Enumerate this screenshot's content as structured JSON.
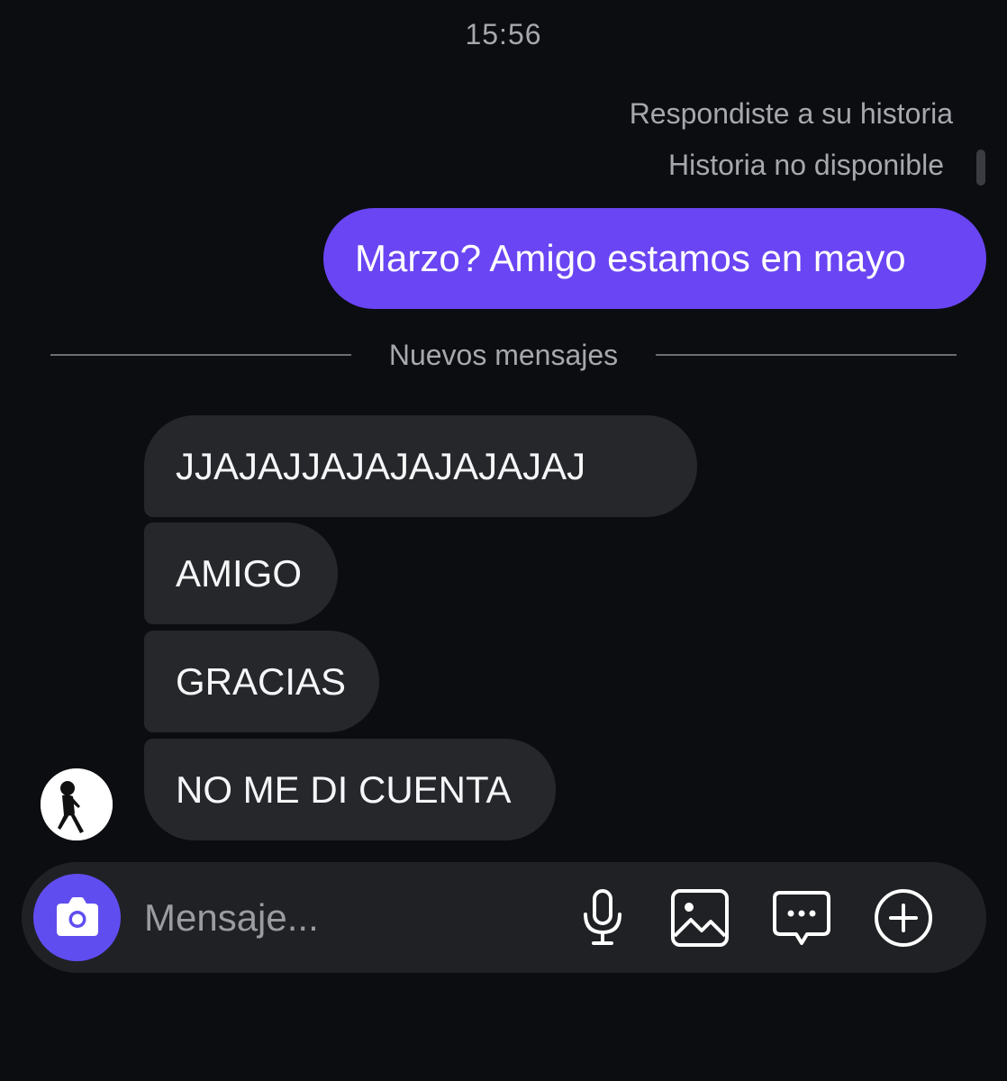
{
  "header": {
    "time": "15:56"
  },
  "story": {
    "reply_label": "Respondiste a su historia",
    "unavailable_label": "Historia no disponible"
  },
  "messages": {
    "outgoing": [
      {
        "text": "Marzo? Amigo estamos en mayo"
      }
    ],
    "divider_label": "Nuevos mensajes",
    "incoming": [
      {
        "text": "JJAJAJJAJAJAJAJAJAJ"
      },
      {
        "text": "AMIGO"
      },
      {
        "text": "GRACIAS"
      },
      {
        "text": "NO ME DI CUENTA"
      }
    ]
  },
  "composer": {
    "placeholder": "Mensaje..."
  },
  "colors": {
    "background": "#0b0d11",
    "outgoing_bubble": "#6a45f3",
    "incoming_bubble": "#26272b",
    "camera_button": "#5f4df0",
    "secondary_text": "#a6a8ad"
  },
  "icons": [
    "camera-icon",
    "microphone-icon",
    "image-icon",
    "sticker-icon",
    "plus-icon"
  ]
}
